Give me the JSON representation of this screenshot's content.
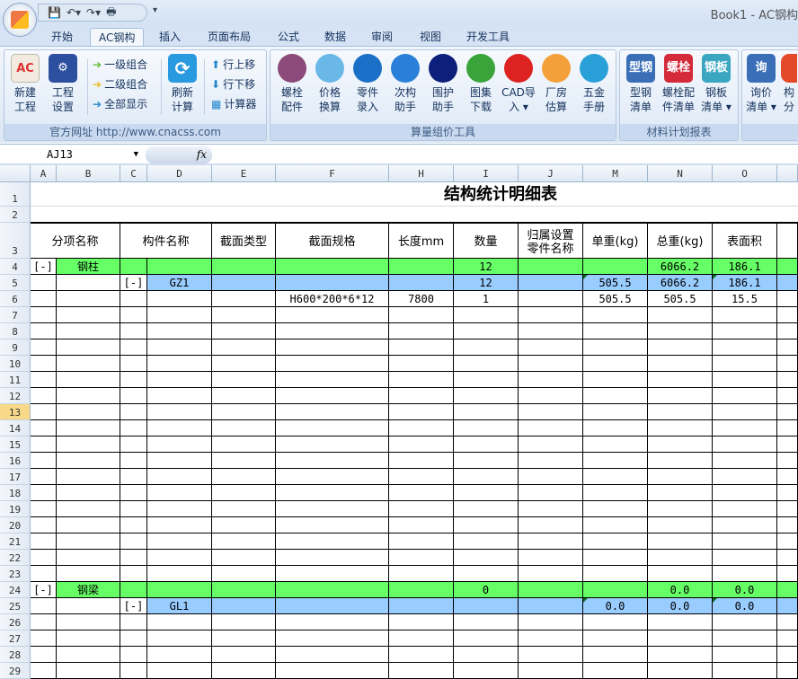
{
  "window": {
    "title": "Book1 - AC钢构"
  },
  "tabs": [
    "开始",
    "AC钢构",
    "插入",
    "页面布局",
    "公式",
    "数据",
    "审阅",
    "视图",
    "开发工具"
  ],
  "ribbon": {
    "g1": {
      "label": "官方网址 http://www.cnacss.com",
      "new": "新建\n工程",
      "new_icon": "AC",
      "settings": "工程\n设置",
      "level1": "一级组合",
      "level2": "二级组合",
      "showall": "全部显示",
      "refresh": "刷新\n计算",
      "up": "行上移",
      "down": "行下移",
      "calc": "计算器"
    },
    "g2": {
      "label": "算量组价工具",
      "items": [
        {
          "t": "螺栓\n配件",
          "c": "#8b4a7a"
        },
        {
          "t": "价格\n换算",
          "c": "#6ab8e8"
        },
        {
          "t": "零件\n录入",
          "c": "#1a6fc6"
        },
        {
          "t": "次构\n助手",
          "c": "#2a7fd8"
        },
        {
          "t": "围护\n助手",
          "c": "#0c1f7a"
        },
        {
          "t": "图集\n下载",
          "c": "#3aa33a"
        },
        {
          "t": "CAD导\n入 ▾",
          "c": "#d22"
        },
        {
          "t": "厂房\n估算",
          "c": "#f4a03a"
        },
        {
          "t": "五金\n手册",
          "c": "#2aa0d8"
        }
      ]
    },
    "g3": {
      "label": "材料计划报表",
      "items": [
        {
          "t": "型钢\n清单",
          "i": "型钢",
          "c": "#3a6fb8"
        },
        {
          "t": "螺栓配\n件清单",
          "i": "螺栓",
          "c": "#d42a3a"
        },
        {
          "t": "钢板\n清单 ▾",
          "i": "钢板",
          "c": "#3aa6c0"
        }
      ]
    },
    "g4": {
      "items": [
        {
          "t": "询价\n清单 ▾",
          "i": "询",
          "c": "#3a6fb8"
        },
        {
          "t": "构\n分",
          "i": "",
          "c": "#e24a2a"
        }
      ]
    }
  },
  "formula": {
    "namebox": "AJ13",
    "fx": "fx",
    "value": ""
  },
  "columns": [
    "A",
    "B",
    "C",
    "D",
    "E",
    "F",
    "H",
    "I",
    "J",
    "M",
    "N",
    "O",
    ""
  ],
  "sheet": {
    "title": "结构统计明细表",
    "headers": [
      "分项名称",
      "构件名称",
      "截面类型",
      "截面规格",
      "长度mm",
      "数量",
      "归属设置\n零件名称",
      "单重(kg)",
      "总重(kg)",
      "表面积",
      ""
    ],
    "rows": [
      {
        "row": 4,
        "style": "green",
        "cells": {
          "A": "[-]",
          "B": "钢柱",
          "I": "12",
          "N": "6066.2",
          "O": "186.1"
        }
      },
      {
        "row": 5,
        "style": "blue",
        "cells": {
          "C": "[-]",
          "D": "GZ1",
          "I": "12",
          "M": "505.5",
          "N": "6066.2",
          "O": "186.1"
        }
      },
      {
        "row": 6,
        "style": "",
        "cells": {
          "F": "H600*200*6*12",
          "H": "7800",
          "I": "1",
          "M": "505.5",
          "N": "505.5",
          "O": "15.5"
        }
      },
      {
        "row": 24,
        "style": "green",
        "cells": {
          "A": "[-]",
          "B": "钢梁",
          "I": "0",
          "N": "0.0",
          "O": "0.0"
        }
      },
      {
        "row": 25,
        "style": "blue",
        "cells": {
          "C": "[-]",
          "D": "GL1",
          "M": "0.0",
          "N": "0.0",
          "O": "0.0"
        }
      }
    ],
    "selected_row": 13
  }
}
